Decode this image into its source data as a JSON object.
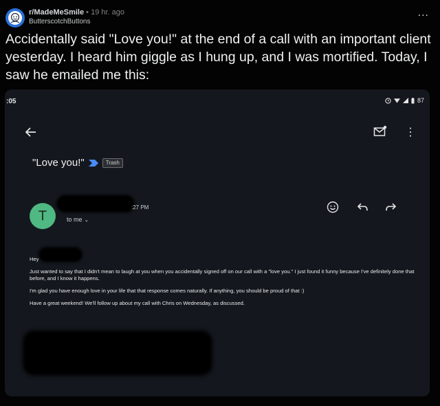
{
  "post": {
    "subreddit": "r/MadeMeSmile",
    "separator": "•",
    "time": "19 hr. ago",
    "username": "ButterscotchButtons",
    "more_label": "...",
    "title": "Accidentally said \"Love you!\" at the end of a call with an important client yesterday. I heard him giggle as I hung up, and I was mortified. Today, I saw he emailed me this:"
  },
  "phone": {
    "status_time": ":05",
    "battery": "87",
    "subject": "\"Love you!\"",
    "label": "Trash",
    "sender_initial": "T",
    "message_time": ":27 PM",
    "recipient": "to me",
    "greeting": "Hey",
    "paragraphs": [
      "Just wanted to say that I didn't mean to laugh at you when you accidentally signed off on our call with a \"love you.\" I just found it funny because I've definitely done that before, and I know it happens.",
      "I'm glad you have enough love in your life that that response comes naturally. If anything, you should be proud of that :)",
      "Have a great weekend! We'll follow up about my call with Chris on Wednesday, as discussed."
    ]
  },
  "icons": {
    "avatar": "subreddit-avatar-icon",
    "back": "arrow-left-icon",
    "archive": "archive-mail-icon",
    "overflow": "vertical-dots-icon",
    "importance": "importance-marker-icon",
    "emoji": "emoji-react-icon",
    "reply": "reply-icon",
    "forward": "forward-icon"
  },
  "colors": {
    "background": "#030303",
    "card": "#14181e",
    "sender_avatar": "#4fb883",
    "importance": "#4a8cff"
  }
}
